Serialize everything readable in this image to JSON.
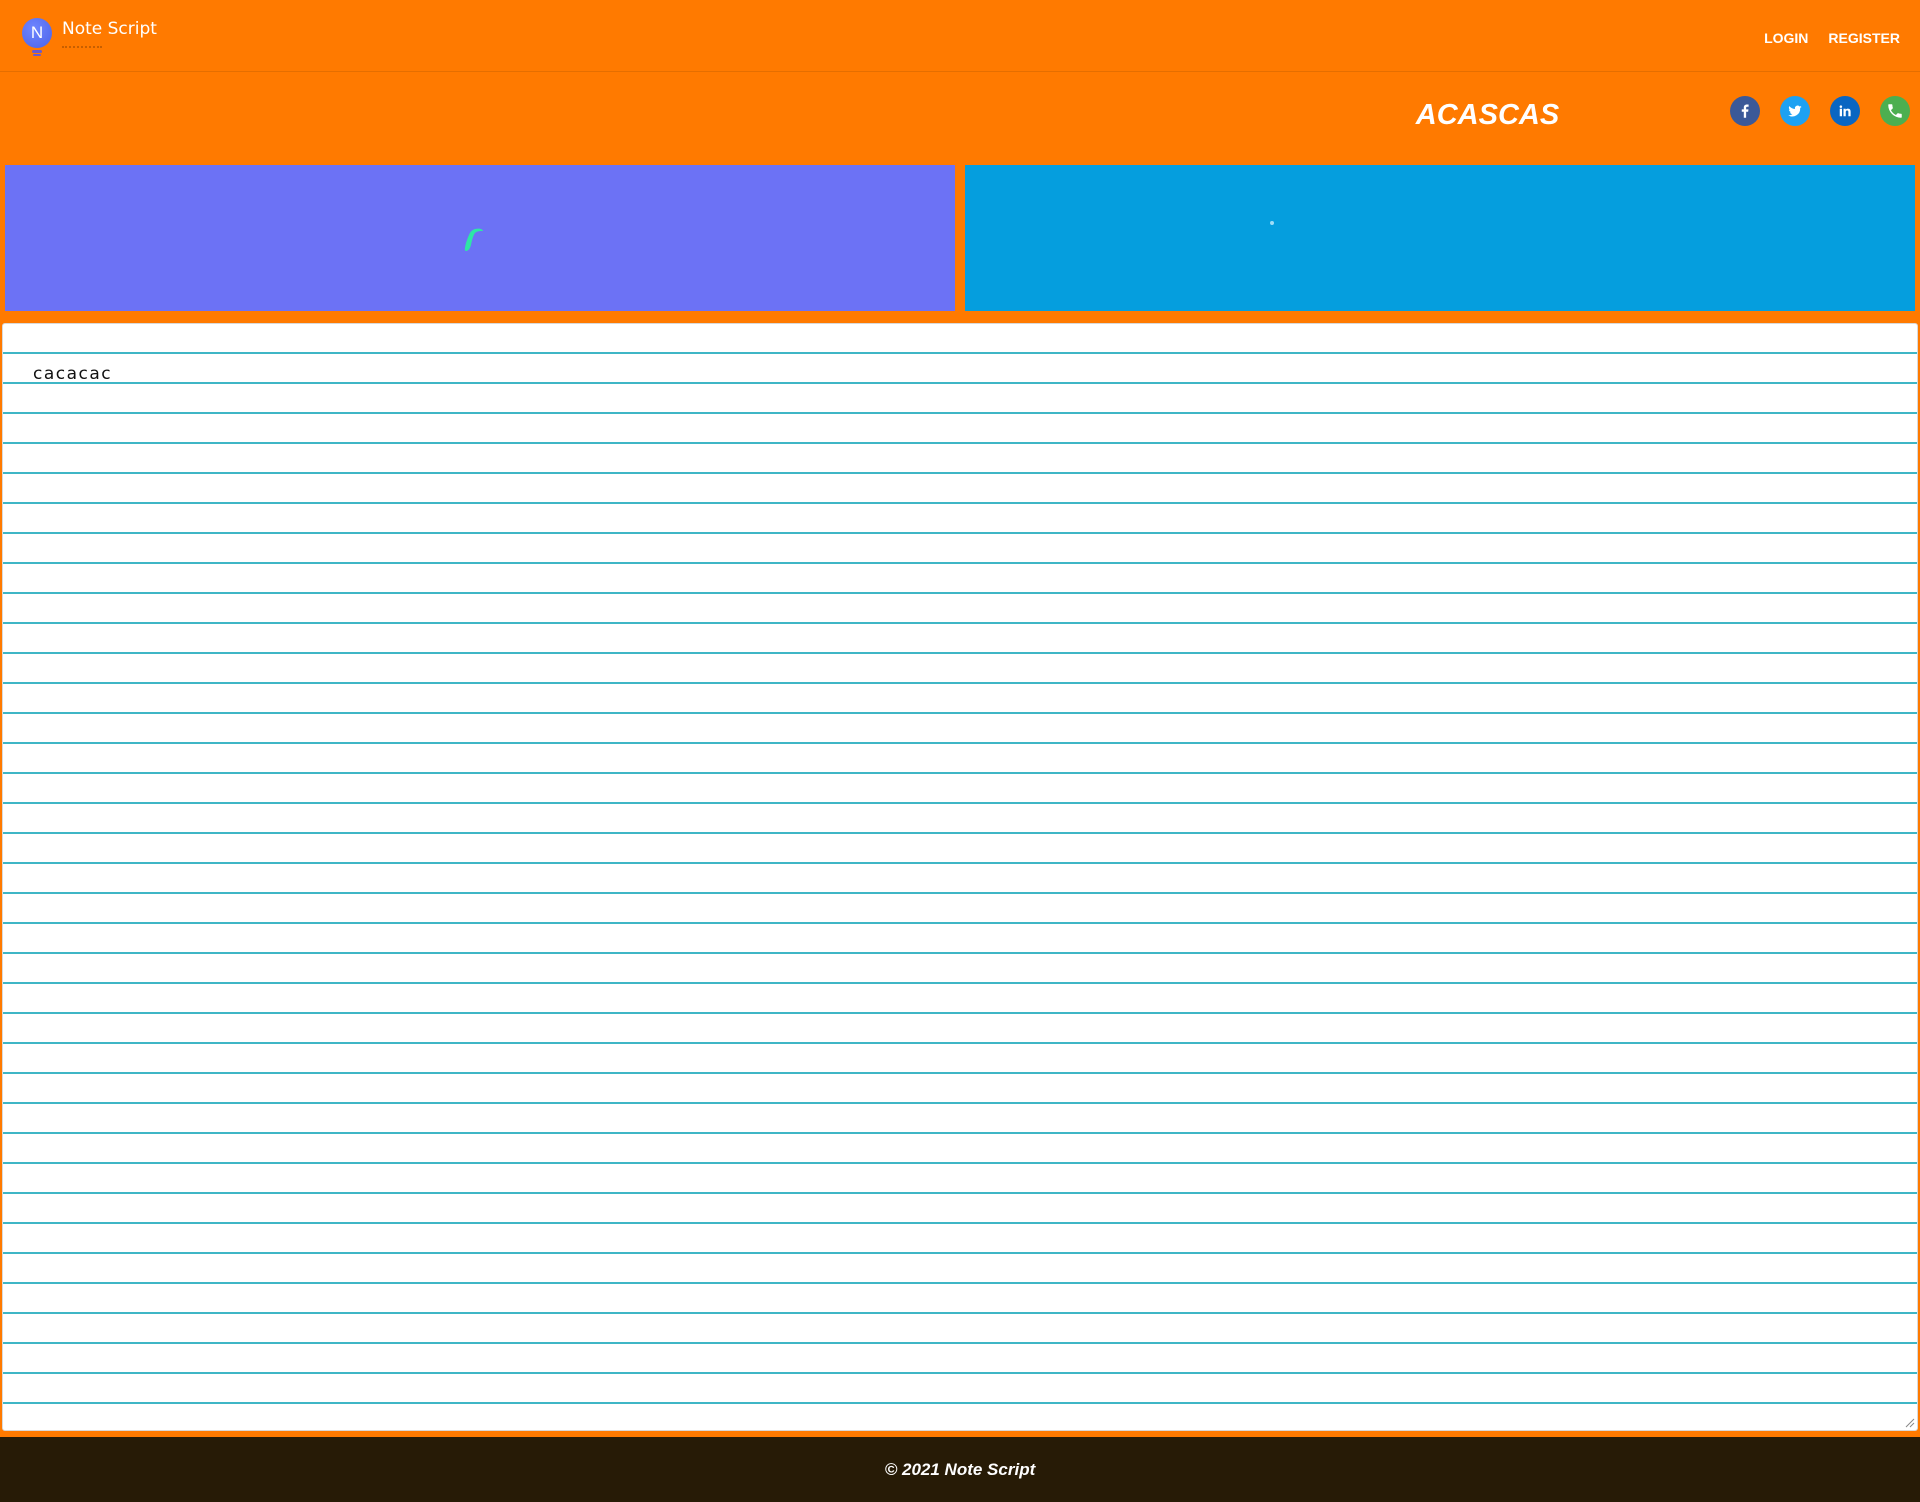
{
  "navbar": {
    "brand_name": "Note Script",
    "brand_letter": "N",
    "links": [
      {
        "label": "LOGIN"
      },
      {
        "label": "REGISTER"
      }
    ]
  },
  "note": {
    "title": "ACASCAS",
    "content": "cacacac"
  },
  "socials": [
    {
      "icon": "facebook-icon",
      "color": "#3b5998"
    },
    {
      "icon": "twitter-icon",
      "color": "#1da1f2"
    },
    {
      "icon": "linkedin-icon",
      "color": "#0a66c2"
    },
    {
      "icon": "phone-icon",
      "color": "#4caf50"
    }
  ],
  "panels": {
    "left_color": "#6c72f5",
    "right_color": "#059ede",
    "shape_color": "#2ee6a6"
  },
  "theme": {
    "header_bg": "#ff7a00",
    "line_color": "#3fb6c6",
    "footer_bg": "#271b06"
  },
  "footer": {
    "text": "© 2021 Note Script"
  }
}
